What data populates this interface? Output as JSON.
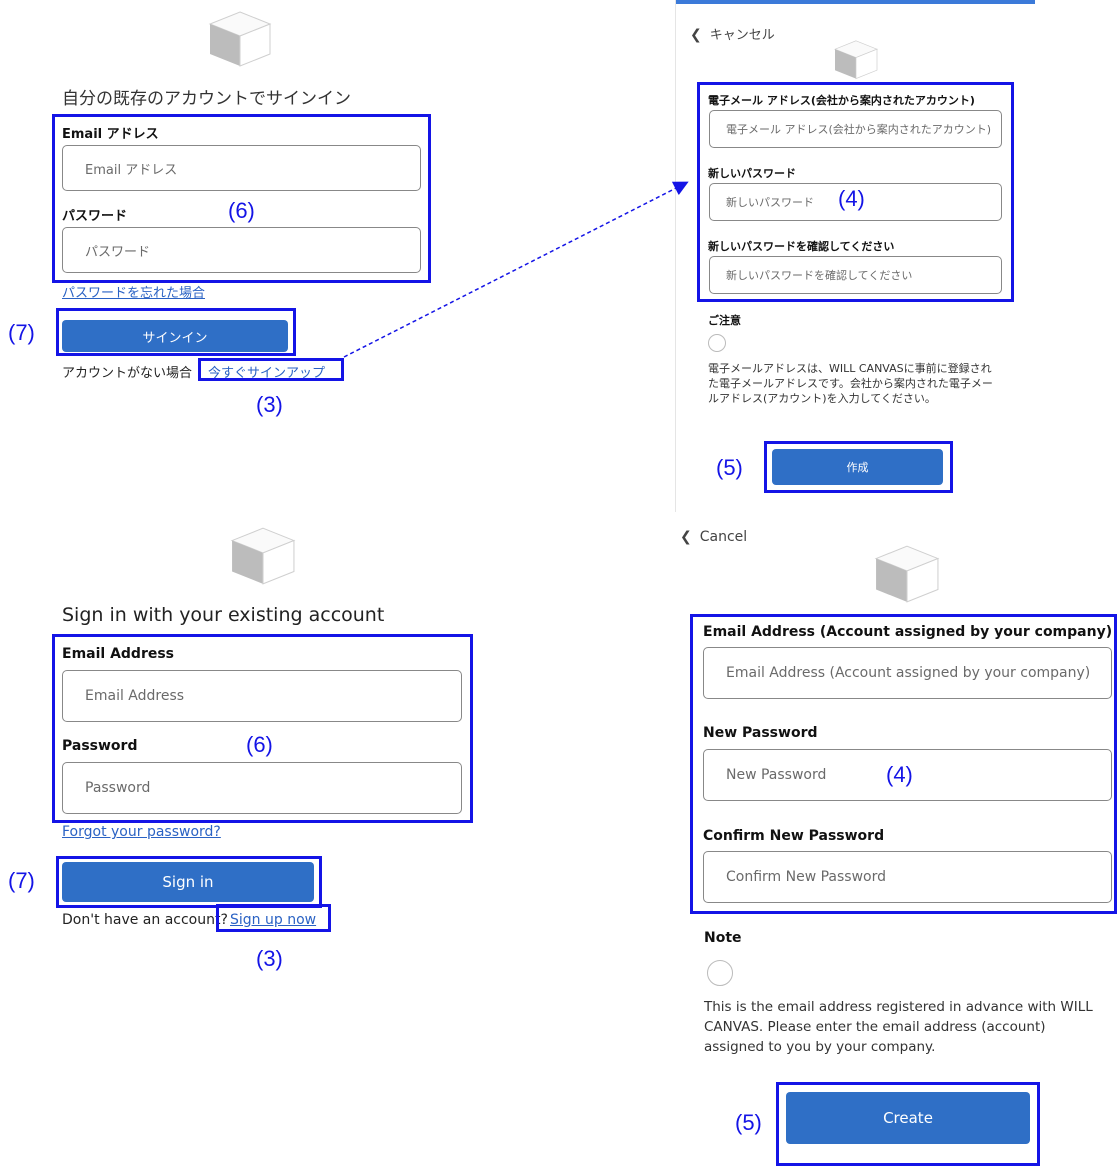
{
  "cube_icon": "cube-logo-icon",
  "chevron_icon": "chevron-left-icon",
  "accent_color": "#2f6fc6",
  "highlight_color": "#1414e6",
  "jp_signin": {
    "title": "自分の既存のアカウントでサインイン",
    "email_label": "Email アドレス",
    "email_placeholder": "Email アドレス",
    "password_label": "パスワード",
    "password_placeholder": "パスワード",
    "forgot_link": "パスワードを忘れた場合",
    "signin_button": "サインイン",
    "no_account_text": "アカウントがない場合",
    "signup_link": "今すぐサインアップ"
  },
  "jp_signup": {
    "cancel": "キャンセル",
    "email_label": "電子メール アドレス(会社から案内されたアカウント)",
    "email_placeholder": "電子メール アドレス(会社から案内されたアカウント)",
    "new_password_label": "新しいパスワード",
    "new_password_placeholder": "新しいパスワード",
    "confirm_label": "新しいパスワードを確認してください",
    "confirm_placeholder": "新しいパスワードを確認してください",
    "note_label": "ご注意",
    "note_text": "電子メールアドレスは、WILL CANVASに事前に登録された電子メールアドレスです。会社から案内された電子メールアドレス(アカウント)を入力してください。",
    "create_button": "作成"
  },
  "en_signin": {
    "title": "Sign in with your existing account",
    "email_label": "Email Address",
    "email_placeholder": "Email Address",
    "password_label": "Password",
    "password_placeholder": "Password",
    "forgot_link": "Forgot your password?",
    "signin_button": "Sign in",
    "no_account_text": "Don't have an account?",
    "signup_link": "Sign up now"
  },
  "en_signup": {
    "cancel": "Cancel",
    "email_label": "Email Address (Account assigned by your company)",
    "email_placeholder": "Email Address (Account assigned by your company)",
    "new_password_label": "New Password",
    "new_password_placeholder": "New Password",
    "confirm_label": "Confirm New Password",
    "confirm_placeholder": "Confirm New Password",
    "note_label": "Note",
    "note_text": "This is the email address registered in advance with WILL CANVAS. Please enter the email address (account) assigned to you by your company.",
    "create_button": "Create"
  },
  "annotations": {
    "n3": "(3)",
    "n4": "(4)",
    "n5": "(5)",
    "n6": "(6)",
    "n7": "(7)"
  }
}
